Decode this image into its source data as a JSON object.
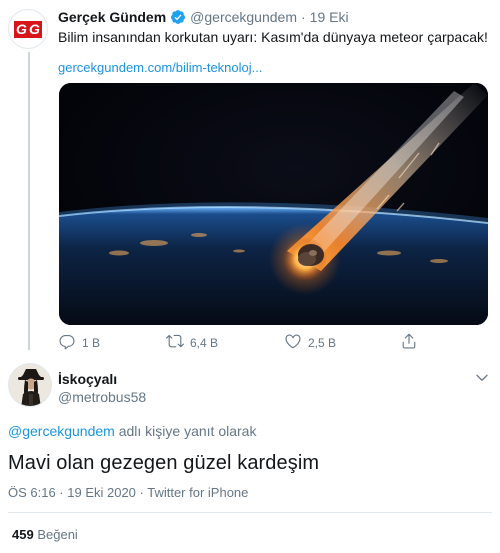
{
  "parent_tweet": {
    "avatar_letters": "GG",
    "name": "Gerçek Gündem",
    "handle": "@gercekgundem",
    "separator": "·",
    "time": "19 Eki",
    "text": "Bilim insanından korkutan uyarı: Kasım'da dünyaya meteor çarpacak!",
    "link": "gercekgundem.com/bilim-teknoloj...",
    "actions": {
      "reply_count": "1 B",
      "retweet_count": "6,4 B",
      "like_count": "2,5 B"
    },
    "colors": {
      "verified": "#1da1f2",
      "link": "#1b95e0",
      "logo_red": "#d7141a"
    }
  },
  "reply_tweet": {
    "name": "İskoçyalı",
    "handle": "@metrobus58",
    "replying_mention": "@gercekgundem",
    "replying_suffix": " adlı kişiye yanıt olarak",
    "text": "Mavi olan gezegen güzel kardeşim",
    "meta": "ÖS 6:16 · 19 Eki 2020 · Twitter for iPhone",
    "like_count": "459",
    "like_label": "Beğeni"
  }
}
